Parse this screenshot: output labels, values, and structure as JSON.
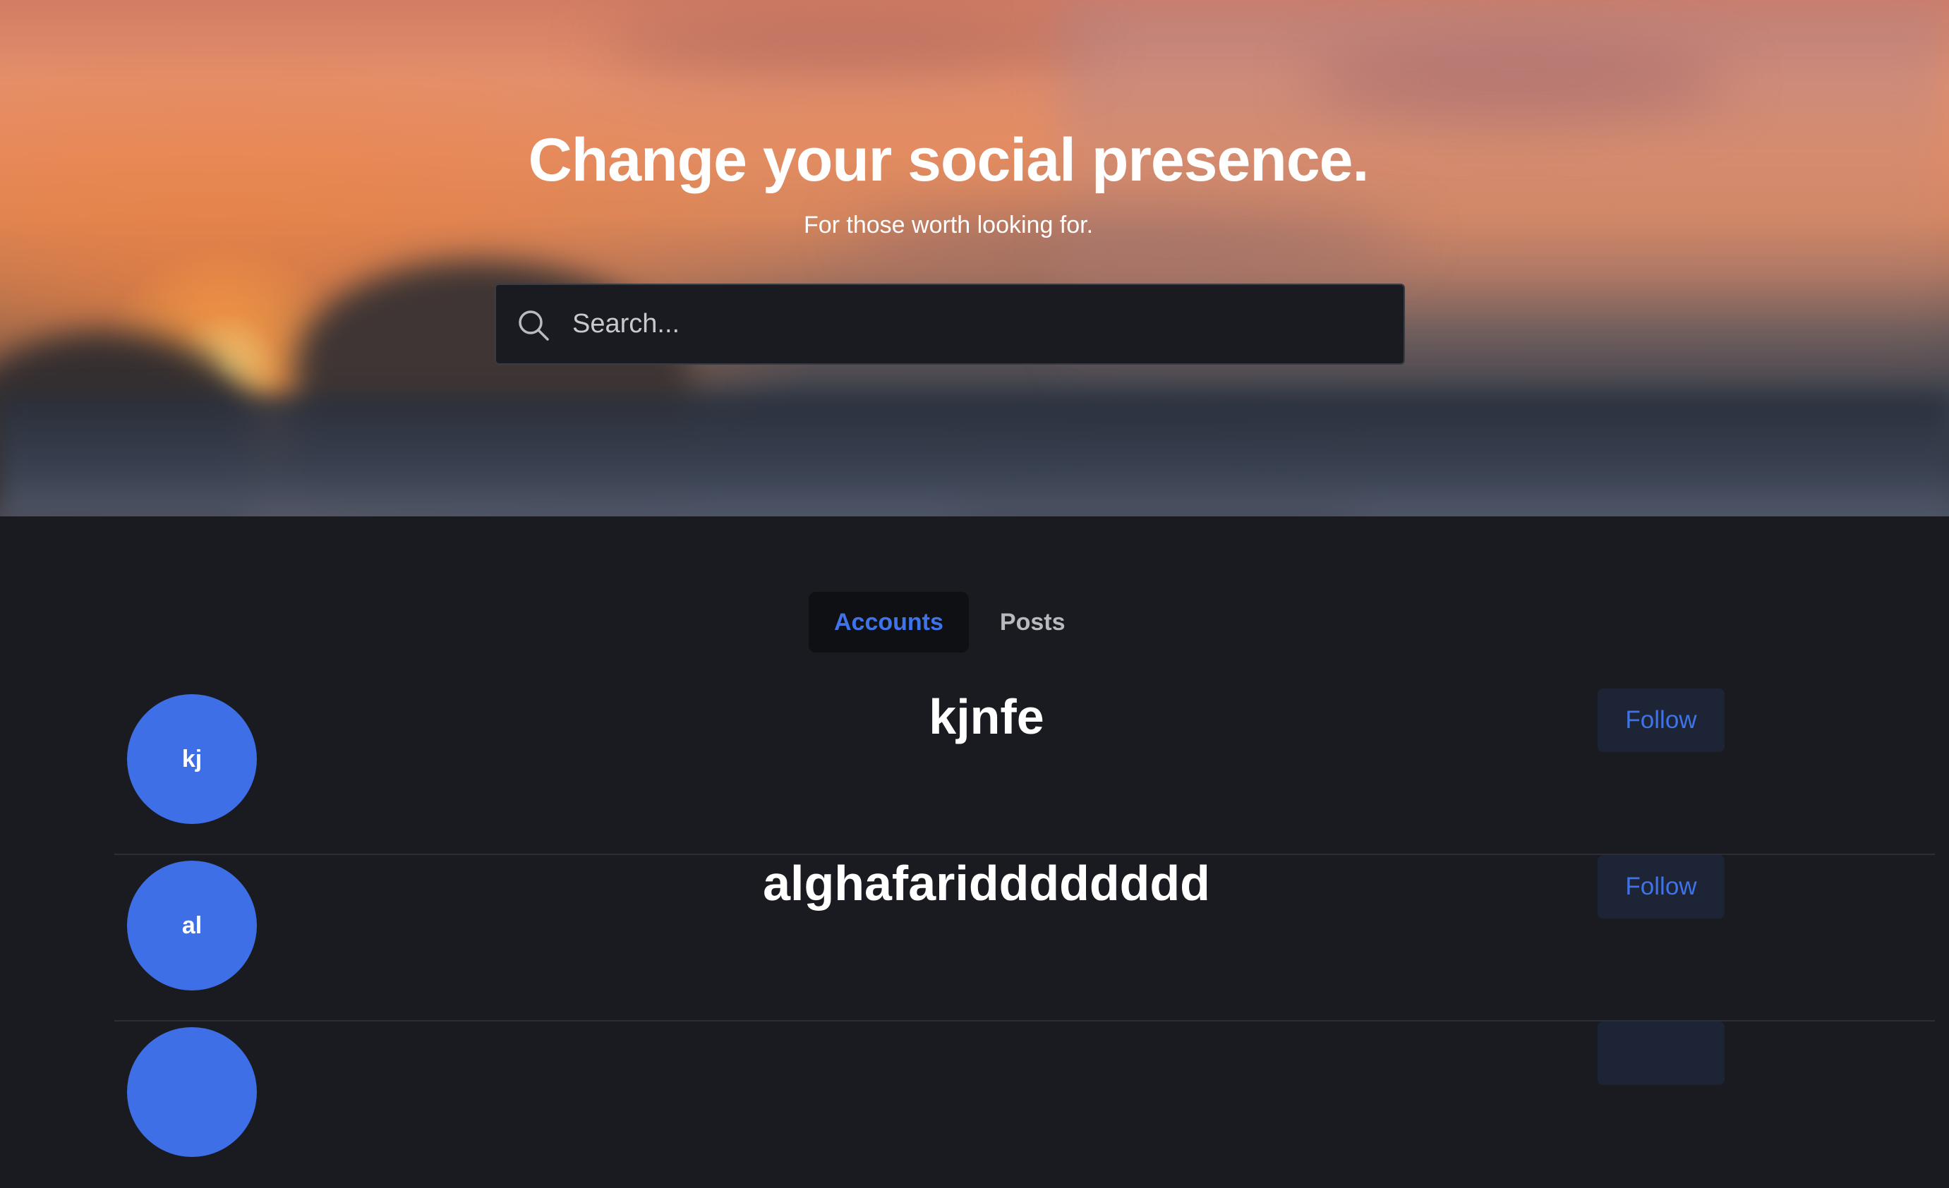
{
  "hero": {
    "title": "Change your social presence.",
    "subtitle": "For those worth looking for."
  },
  "search": {
    "placeholder": "Search...",
    "value": ""
  },
  "tabs": [
    {
      "label": "Accounts",
      "active": true
    },
    {
      "label": "Posts",
      "active": false
    }
  ],
  "accounts": [
    {
      "initials": "kj",
      "username": "kjnfe",
      "follow_label": "Follow"
    },
    {
      "initials": "al",
      "username": "alghafaridddddddd",
      "follow_label": "Follow"
    },
    {
      "initials": "",
      "username": "",
      "follow_label": ""
    }
  ],
  "colors": {
    "accent": "#3f73ea",
    "avatar_bg": "#3f6fe6",
    "page_bg": "#1a1b20",
    "follow_bg": "#1d2435"
  }
}
